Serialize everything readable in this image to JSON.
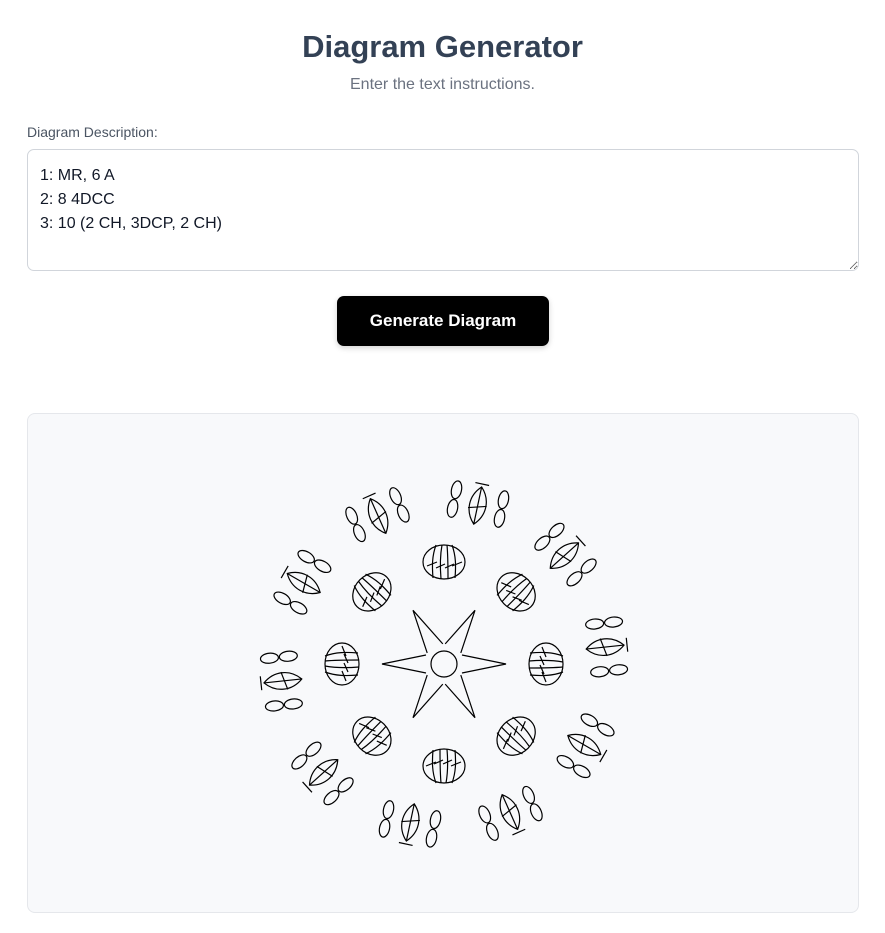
{
  "header": {
    "title": "Diagram Generator",
    "subtitle": "Enter the text instructions."
  },
  "form": {
    "label": "Diagram Description:",
    "value": "1: MR, 6 A\n2: 8 4DCC\n3: 10 (2 CH, 3DCP, 2 CH)"
  },
  "actions": {
    "generate_label": "Generate Diagram"
  },
  "diagram": {
    "rounds": [
      {
        "round": 1,
        "stitch": "A",
        "count": 6,
        "start": "MR"
      },
      {
        "round": 2,
        "stitch": "4DCC",
        "count": 8
      },
      {
        "round": 3,
        "stitch": "2 CH, 3DCP, 2 CH",
        "count": 10
      }
    ],
    "stroke_color": "#000000"
  }
}
